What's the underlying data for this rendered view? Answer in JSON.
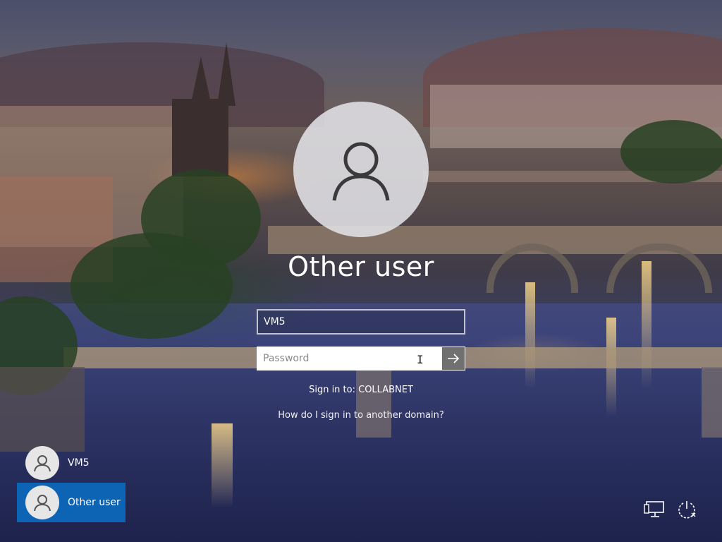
{
  "login": {
    "display_name": "Other user",
    "username_value": "VM5",
    "password_placeholder": "Password",
    "sign_in_to": "Sign in to: COLLABNET",
    "other_domain_link": "How do I sign in to another domain?"
  },
  "user_switcher": {
    "items": [
      {
        "label": "VM5",
        "selected": false
      },
      {
        "label": "Other user",
        "selected": true
      }
    ]
  },
  "icons": {
    "avatar": "user-silhouette-icon",
    "submit": "arrow-right-icon",
    "network": "network-icon",
    "power": "power-icon"
  },
  "colors": {
    "selected_tile": "#0e64b4",
    "submit_button": "#707070",
    "avatar_bg": "#e1e1e6"
  }
}
